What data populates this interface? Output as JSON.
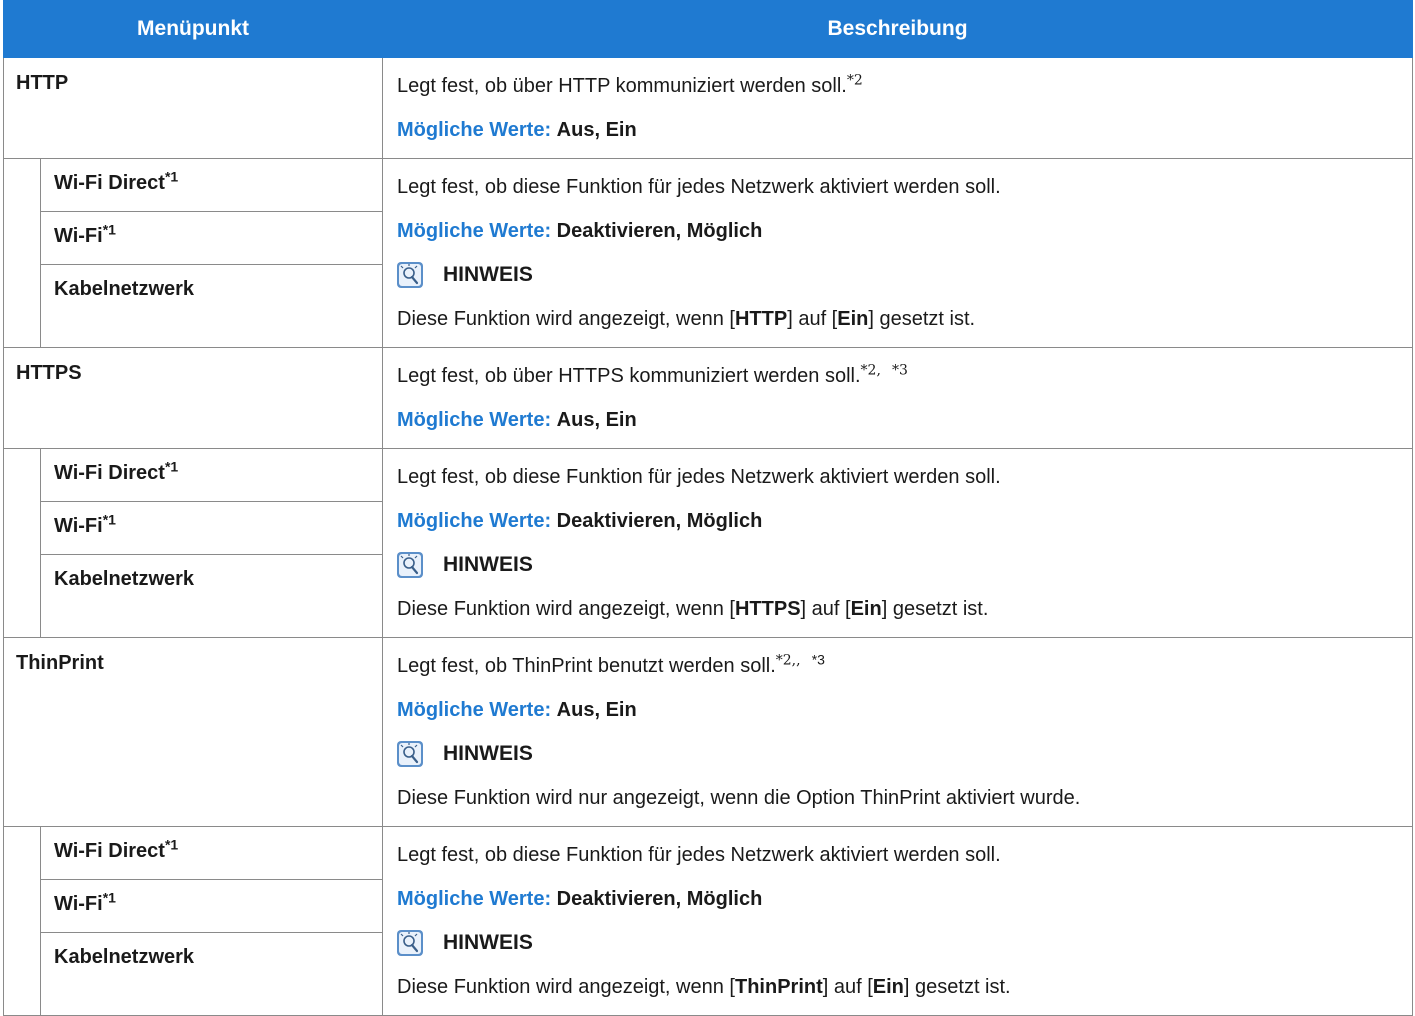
{
  "table": {
    "header": {
      "col1": "Menüpunkt",
      "col2": "Beschreibung"
    },
    "http": {
      "name": "HTTP",
      "desc": "Legt fest, ob über HTTP kommuniziert werden soll.",
      "desc_sup": "*2",
      "pv_label": "Mögliche Werte:",
      "pv_value": "Aus, Ein"
    },
    "http_sub": {
      "items": [
        {
          "label": "Wi-Fi Direct",
          "sup": "*1"
        },
        {
          "label": "Wi-Fi",
          "sup": "*1"
        },
        {
          "label": "Kabelnetzwerk",
          "sup": ""
        }
      ],
      "desc": "Legt fest, ob diese Funktion für jedes Netzwerk aktiviert werden soll.",
      "pv_label": "Mögliche Werte:",
      "pv_value": "Deaktivieren, Möglich",
      "note_title": "HINWEIS",
      "note_pre": "Diese Funktion wird angezeigt, wenn [",
      "note_b1": "HTTP",
      "note_mid": "] auf [",
      "note_b2": "Ein",
      "note_post": "] gesetzt ist."
    },
    "https": {
      "name": "HTTPS",
      "desc": "Legt fest, ob über HTTPS kommuniziert werden soll.",
      "desc_sup1": "*2,",
      "desc_sup2": "*3",
      "pv_label": "Mögliche Werte:",
      "pv_value": "Aus, Ein"
    },
    "https_sub": {
      "items": [
        {
          "label": "Wi-Fi Direct",
          "sup": "*1"
        },
        {
          "label": "Wi-Fi",
          "sup": "*1"
        },
        {
          "label": "Kabelnetzwerk",
          "sup": ""
        }
      ],
      "desc": "Legt fest, ob diese Funktion für jedes Netzwerk aktiviert werden soll.",
      "pv_label": "Mögliche Werte:",
      "pv_value": "Deaktivieren, Möglich",
      "note_title": "HINWEIS",
      "note_pre": "Diese Funktion wird angezeigt, wenn [",
      "note_b1": "HTTPS",
      "note_mid": "] auf [",
      "note_b2": "Ein",
      "note_post": "] gesetzt ist."
    },
    "thinprint": {
      "name": "ThinPrint",
      "desc": "Legt fest, ob ThinPrint benutzt werden soll.",
      "desc_sup1": "*2,",
      "desc_sup2": ",",
      "desc_sup3": "*3",
      "pv_label": "Mögliche Werte:",
      "pv_value": "Aus, Ein",
      "note_title": "HINWEIS",
      "note_text": "Diese Funktion wird nur angezeigt, wenn die Option ThinPrint aktiviert wurde."
    },
    "thinprint_sub": {
      "items": [
        {
          "label": "Wi-Fi Direct",
          "sup": "*1"
        },
        {
          "label": "Wi-Fi",
          "sup": "*1"
        },
        {
          "label": "Kabelnetzwerk",
          "sup": ""
        }
      ],
      "desc": "Legt fest, ob diese Funktion für jedes Netzwerk aktiviert werden soll.",
      "pv_label": "Mögliche Werte:",
      "pv_value": "Deaktivieren, Möglich",
      "note_title": "HINWEIS",
      "note_pre": "Diese Funktion wird angezeigt, wenn [",
      "note_b1": "ThinPrint",
      "note_mid": "] auf [",
      "note_b2": "Ein",
      "note_post": "] gesetzt ist."
    }
  },
  "icons": {
    "note": "lightbulb-icon"
  },
  "colors": {
    "header_bg": "#1f7ad1",
    "label_blue": "#1f7ad1",
    "border": "#8a8a8a"
  }
}
